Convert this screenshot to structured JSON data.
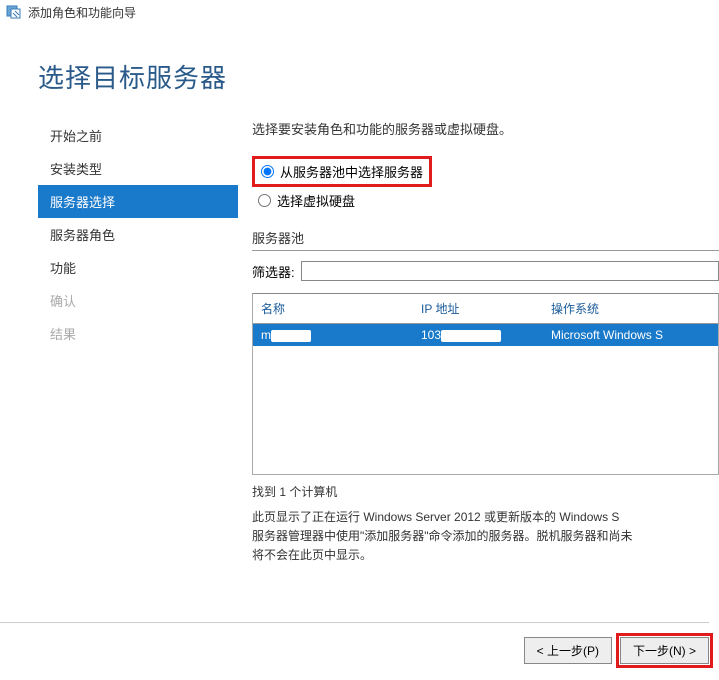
{
  "titleBar": {
    "title": "添加角色和功能向导"
  },
  "header": {
    "pageTitle": "选择目标服务器"
  },
  "sidebar": {
    "items": [
      {
        "label": "开始之前",
        "state": "enabled"
      },
      {
        "label": "安装类型",
        "state": "enabled"
      },
      {
        "label": "服务器选择",
        "state": "active"
      },
      {
        "label": "服务器角色",
        "state": "enabled"
      },
      {
        "label": "功能",
        "state": "enabled"
      },
      {
        "label": "确认",
        "state": "disabled"
      },
      {
        "label": "结果",
        "state": "disabled"
      }
    ]
  },
  "main": {
    "instruction": "选择要安装角色和功能的服务器或虚拟硬盘。",
    "radioOptions": {
      "opt1": "从服务器池中选择服务器",
      "opt2": "选择虚拟硬盘"
    },
    "poolLabel": "服务器池",
    "filterLabel": "筛选器:",
    "filterValue": "",
    "table": {
      "headers": {
        "col1": "名称",
        "col2": "IP 地址",
        "col3": "操作系统"
      },
      "rows": [
        {
          "name": "m",
          "ip": "103",
          "os": "Microsoft Windows S"
        }
      ]
    },
    "countText": "找到 1 个计算机",
    "note": "此页显示了正在运行 Windows Server 2012 或更新版本的 Windows S\n服务器管理器中使用\"添加服务器\"命令添加的服务器。脱机服务器和尚未\n将不会在此页中显示。"
  },
  "footer": {
    "prev": "< 上一步(P)",
    "next": "下一步(N) >"
  }
}
